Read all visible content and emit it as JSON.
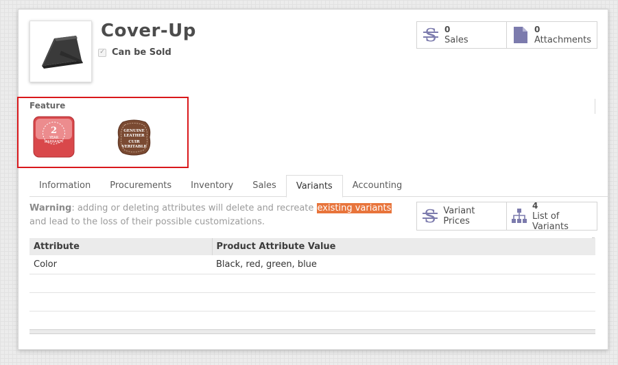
{
  "product": {
    "name": "Cover-Up",
    "can_be_sold_label": "Can be Sold",
    "can_be_sold": true
  },
  "stat_buttons": [
    {
      "icon": "dollar-icon",
      "count": "0",
      "label": "Sales"
    },
    {
      "icon": "document-icon",
      "count": "0",
      "label": "Attachments"
    }
  ],
  "feature": {
    "label": "Feature",
    "badges": [
      {
        "icon": "warranty-badge-icon",
        "text_lines": [
          "2",
          "YEAR",
          "WARRANTY"
        ]
      },
      {
        "icon": "genuine-leather-badge-icon",
        "text_lines": [
          "GENUINE",
          "LEATHER",
          "CUIR",
          "VERITABLE"
        ]
      }
    ]
  },
  "tabs": [
    "Information",
    "Procurements",
    "Inventory",
    "Sales",
    "Variants",
    "Accounting"
  ],
  "active_tab": "Variants",
  "warning": {
    "prefix": "Warning",
    "text_before": ": adding or deleting attributes will delete and recreate ",
    "highlight": "existing variants",
    "text_after": " and lead to the loss of their possible customizations."
  },
  "variant_buttons": [
    {
      "icon": "dollar-icon",
      "count": "",
      "label": "Variant Prices"
    },
    {
      "icon": "hierarchy-icon",
      "count": "4",
      "label": "List of Variants"
    }
  ],
  "attribute_table": {
    "columns": [
      "Attribute",
      "Product Attribute Value"
    ],
    "rows": [
      [
        "Color",
        "Black, red, green, blue"
      ]
    ]
  },
  "colors": {
    "accent": "#7c7bad",
    "highlight": "#e8743b",
    "callout_border": "#d9171a"
  }
}
